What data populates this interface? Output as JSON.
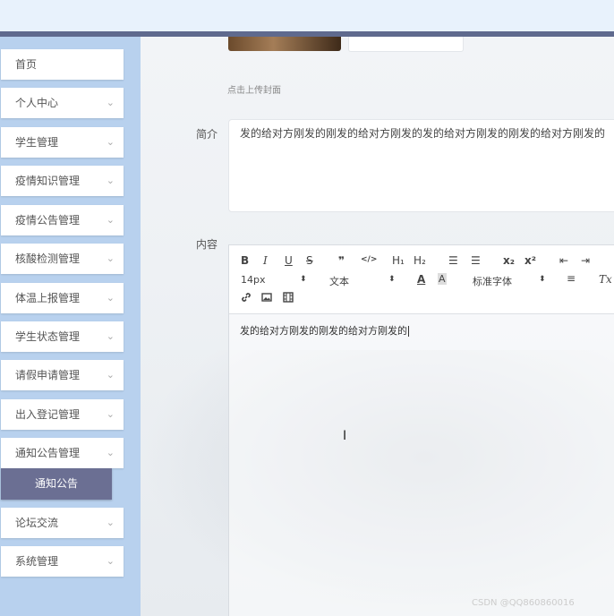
{
  "sidebar": {
    "items": [
      {
        "label": "首页",
        "has_chevron": false
      },
      {
        "label": "个人中心",
        "has_chevron": true
      },
      {
        "label": "学生管理",
        "has_chevron": true
      },
      {
        "label": "疫情知识管理",
        "has_chevron": true
      },
      {
        "label": "疫情公告管理",
        "has_chevron": true
      },
      {
        "label": "核酸检测管理",
        "has_chevron": true
      },
      {
        "label": "体温上报管理",
        "has_chevron": true
      },
      {
        "label": "学生状态管理",
        "has_chevron": true
      },
      {
        "label": "请假申请管理",
        "has_chevron": true
      },
      {
        "label": "出入登记管理",
        "has_chevron": true
      },
      {
        "label": "通知公告管理",
        "has_chevron": true
      },
      {
        "label": "论坛交流",
        "has_chevron": true
      },
      {
        "label": "系统管理",
        "has_chevron": true
      }
    ],
    "submenu_active": "通知公告",
    "chevron": "⌄"
  },
  "form": {
    "upload_hint": "点击上传封面",
    "summary_label": "简介",
    "summary_value": "发的给对方刚发的刚发的给对方刚发的发的给对方刚发的刚发的给对方刚发的",
    "content_label": "内容",
    "content_value": "发的给对方刚发的刚发的给对方刚发的"
  },
  "editor_toolbar": {
    "bold": "B",
    "italic": "I",
    "underline": "U",
    "strike": "S",
    "quote": "❞",
    "code": "</>",
    "h1": "H₁",
    "h2": "H₂",
    "ordered_list": "☰",
    "bullet_list": "☰",
    "subscript": "x₂",
    "superscript": "x²",
    "outdent": "⇤",
    "indent": "⇥",
    "font_size": "14px",
    "block_type": "文本",
    "font_family": "标准字体",
    "color": "A",
    "background": "A",
    "align": "≡",
    "clear_format": "Tx",
    "link_icon": "link-icon",
    "image_icon": "image-icon",
    "video_icon": "video-icon"
  },
  "watermark": "CSDN @QQ860860016"
}
